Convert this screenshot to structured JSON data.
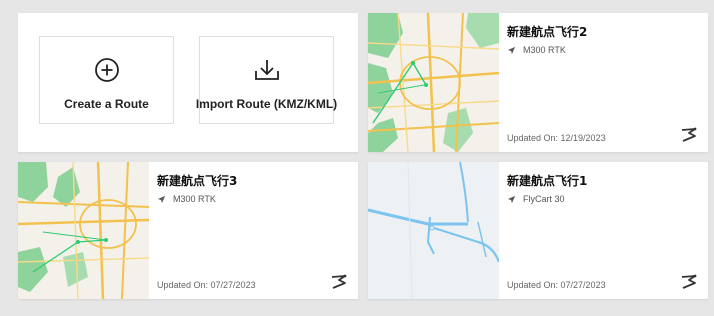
{
  "actions": {
    "create_label": "Create a Route",
    "import_label": "Import Route (KMZ/KML)"
  },
  "icons": {
    "create": "plus-circle-icon",
    "import": "download-icon",
    "aircraft": "send-arrow-icon",
    "route_logo": "route-path-icon"
  },
  "routes": [
    {
      "title": "新建航点飞行2",
      "aircraft": "M300 RTK",
      "updated": "Updated On: 12/19/2023",
      "thumbnail": "city-map"
    },
    {
      "title": "新建航点飞行3",
      "aircraft": "M300 RTK",
      "updated": "Updated On: 07/27/2023",
      "thumbnail": "city-map"
    },
    {
      "title": "新建航点飞行1",
      "aircraft": "FlyCart 30",
      "updated": "Updated On: 07/27/2023",
      "thumbnail": "road-map"
    }
  ],
  "colors": {
    "background": "#e6e6e6",
    "card": "#ffffff",
    "route_line": "#2ecc71",
    "map_green": "#7fcf8f",
    "map_road": "#f2c14e",
    "water_blue": "#7cc4f0"
  }
}
